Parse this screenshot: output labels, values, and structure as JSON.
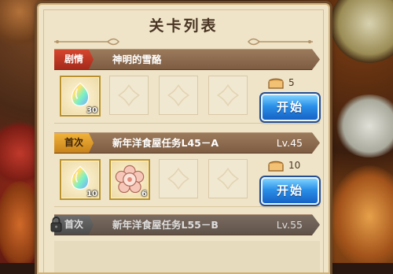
{
  "title": "关卡列表",
  "stages": [
    {
      "tag": "剧情",
      "name": "神明的雪酪",
      "level": "",
      "locked": false,
      "rewards": [
        {
          "icon": "rainbow-crystal-icon",
          "qty": "30"
        }
      ],
      "cost": "5"
    },
    {
      "tag": "首次",
      "name": "新年洋食屋任务L45－A",
      "level": "Lv.45",
      "locked": false,
      "rewards": [
        {
          "icon": "rainbow-crystal-icon",
          "qty": "10"
        },
        {
          "icon": "flower-cookie-icon",
          "qty": "6"
        }
      ],
      "cost": "10"
    },
    {
      "tag": "首次",
      "name": "新年洋食屋任务L55－B",
      "level": "Lv.55",
      "locked": true
    }
  ],
  "start_label": "开始",
  "colors": {
    "story_tag": "#c23a25",
    "first_tag": "#e9a52f",
    "locked_tag": "#5c5c5c",
    "start_button": "#2a8fe8"
  }
}
